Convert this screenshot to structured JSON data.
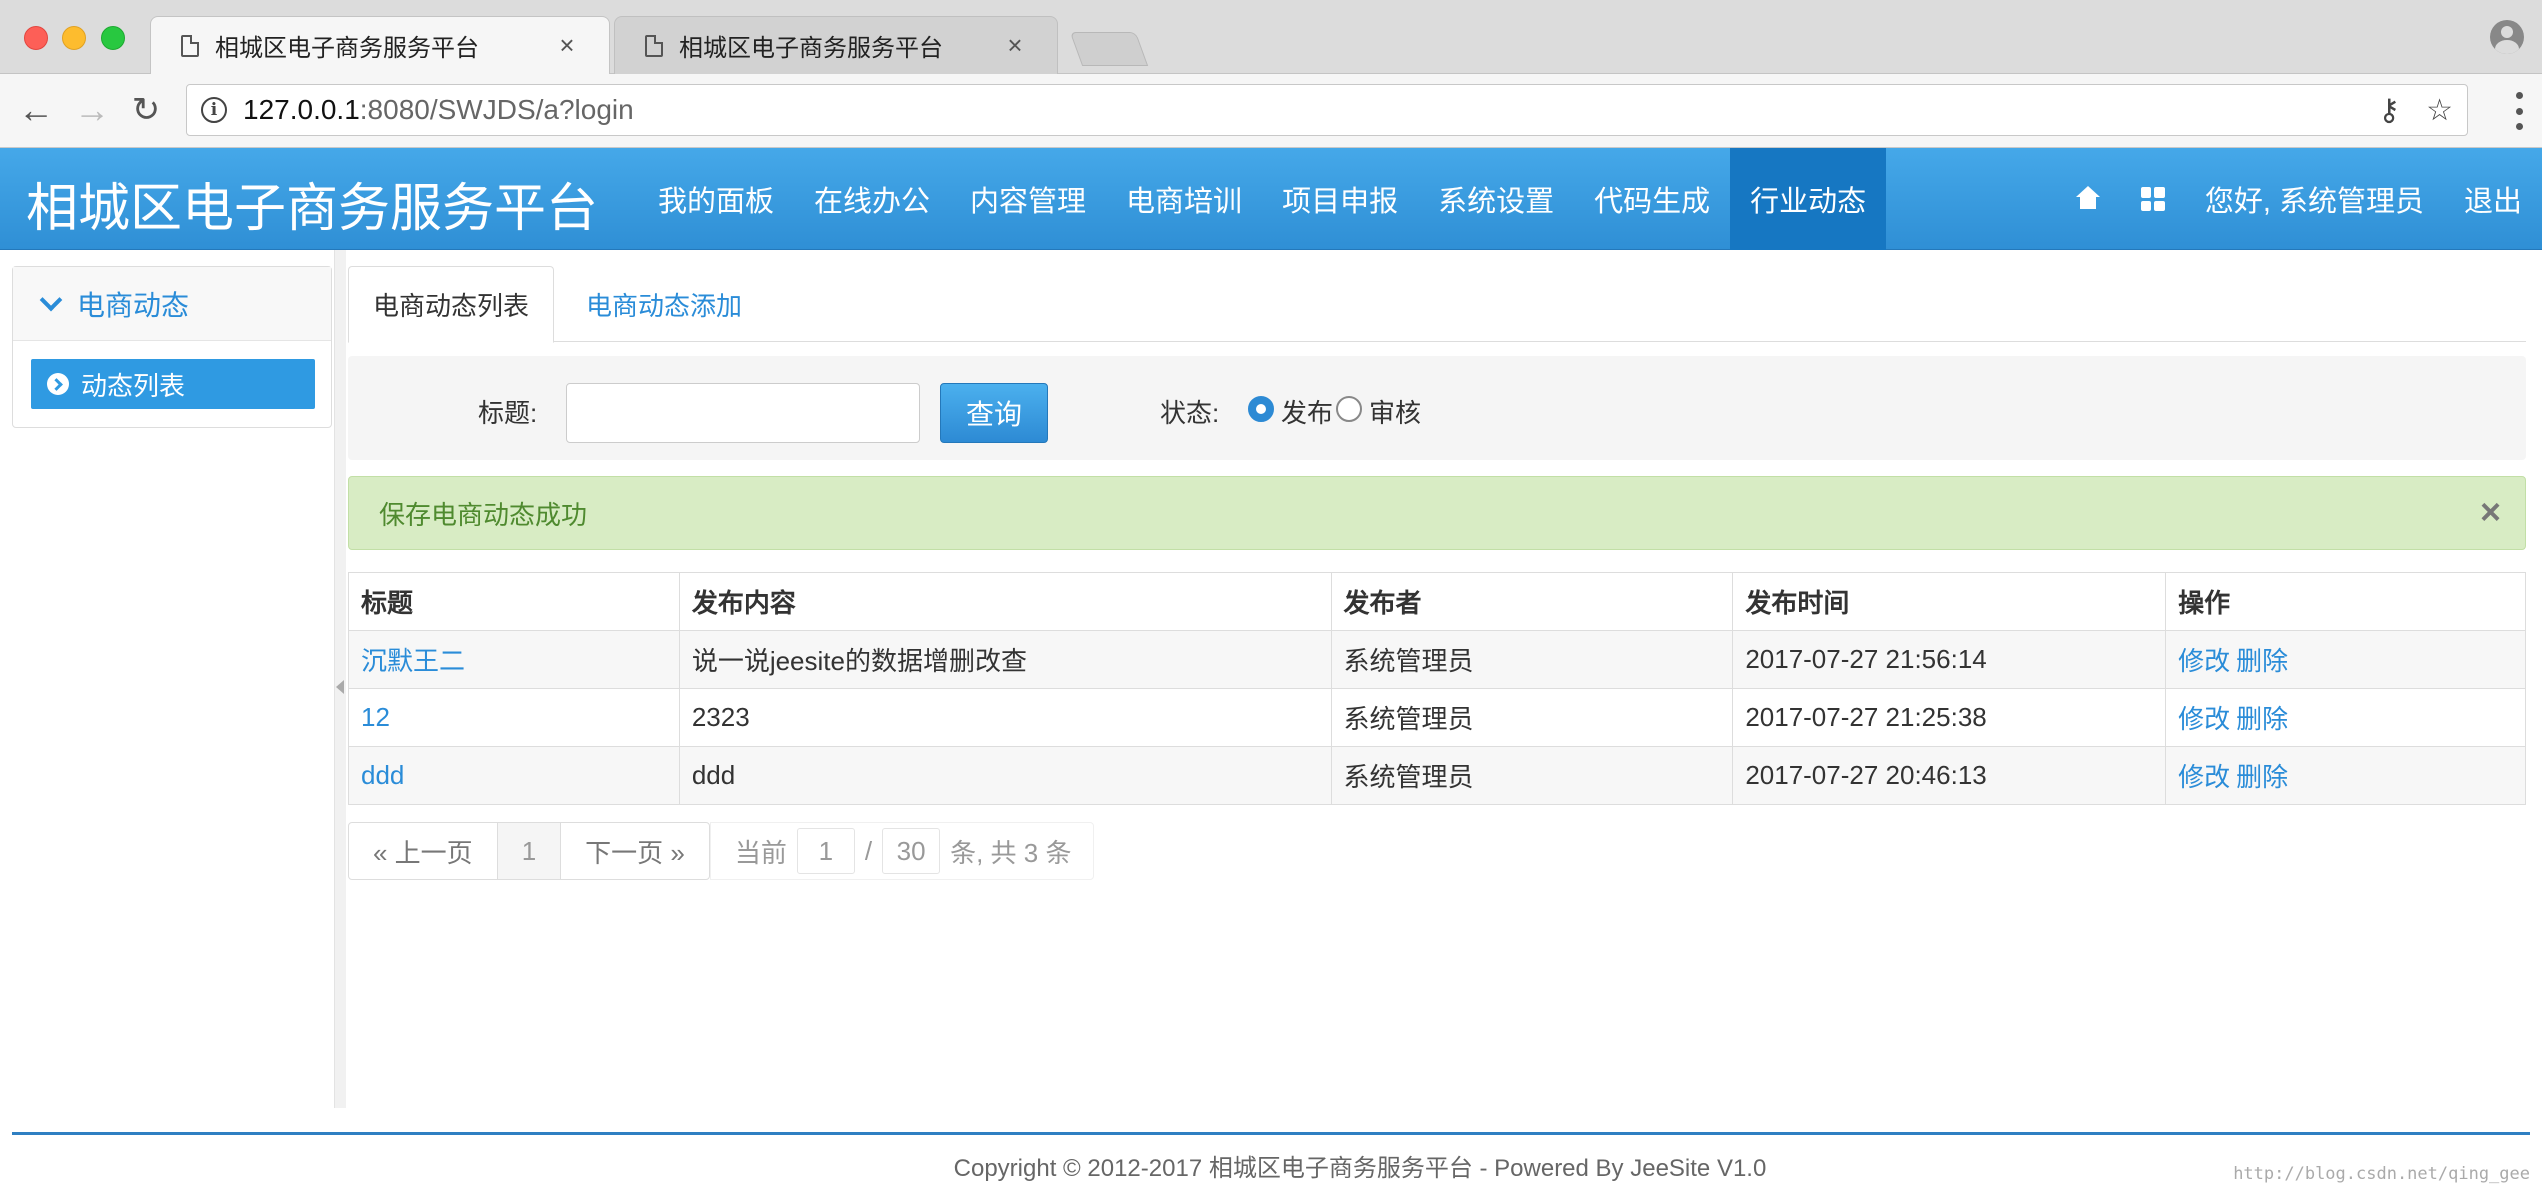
{
  "browser": {
    "tabs": [
      {
        "title": "相城区电子商务服务平台",
        "close": "×"
      },
      {
        "title": "相城区电子商务服务平台",
        "close": "×"
      }
    ],
    "url_host": "127.0.0.1",
    "url_rest": ":8080/SWJDS/a?login"
  },
  "header": {
    "brand": "相城区电子商务服务平台",
    "nav": [
      "我的面板",
      "在线办公",
      "内容管理",
      "电商培训",
      "项目申报",
      "系统设置",
      "代码生成",
      "行业动态"
    ],
    "active_nav": "行业动态",
    "greeting": "您好, 系统管理员",
    "logout": "退出"
  },
  "sidebar": {
    "group": "电商动态",
    "items": [
      {
        "label": "动态列表"
      }
    ]
  },
  "content": {
    "tabs": {
      "list": "电商动态列表",
      "add": "电商动态添加"
    },
    "search": {
      "title_label": "标题:",
      "title_value": "",
      "query_button": "查询",
      "status_label": "状态:",
      "status_options": [
        "发布",
        "审核"
      ],
      "status_selected": "发布"
    },
    "alert": {
      "message": "保存电商动态成功",
      "close": "×"
    },
    "table": {
      "headers": [
        "标题",
        "发布内容",
        "发布者",
        "发布时间",
        "操作"
      ],
      "rows": [
        {
          "title": "沉默王二",
          "content": "说一说jeesite的数据增删改查",
          "author": "系统管理员",
          "time": "2017-07-27 21:56:14",
          "edit": "修改",
          "delete": "删除"
        },
        {
          "title": "12",
          "content": "2323",
          "author": "系统管理员",
          "time": "2017-07-27 21:25:38",
          "edit": "修改",
          "delete": "删除"
        },
        {
          "title": "ddd",
          "content": "ddd",
          "author": "系统管理员",
          "time": "2017-07-27 20:46:13",
          "edit": "修改",
          "delete": "删除"
        }
      ]
    },
    "pager": {
      "prev": "« 上一页",
      "page": "1",
      "next": "下一页 »",
      "current_label": "当前",
      "current_page": "1",
      "sep": "/",
      "page_size": "30",
      "total_text": "条, 共 3 条"
    }
  },
  "footer": {
    "copyright": "Copyright © 2012-2017 相城区电子商务服务平台 - Powered By JeeSite V1.0",
    "watermark": "http://blog.csdn.net/qing_gee"
  },
  "colors": {
    "primary": "#2f8fd5",
    "active_nav": "#1677c2",
    "link": "#2a8cd8",
    "alert_bg": "#d8ecc4"
  }
}
